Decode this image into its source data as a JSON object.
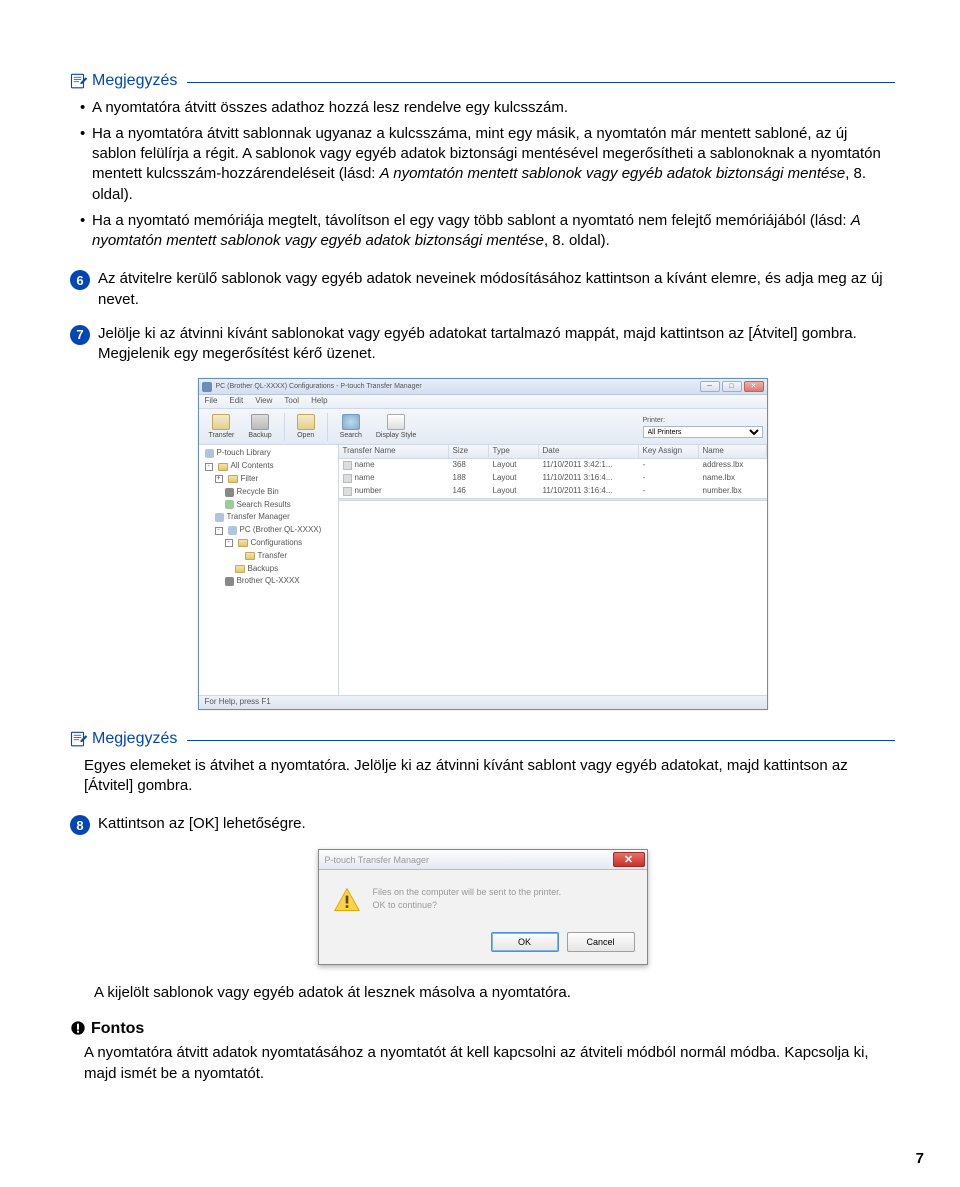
{
  "note1": {
    "title": "Megjegyzés",
    "bullets": [
      "A nyomtatóra átvitt összes adathoz hozzá lesz rendelve egy kulcsszám.",
      "Ha a nyomtatóra átvitt sablonnak ugyanaz a kulcsszáma, mint egy másik, a nyomtatón már mentett sabloné, az új sablon felülírja a régit. A sablonok vagy egyéb adatok biztonsági mentésével megerősítheti a sablonoknak a nyomtatón mentett kulcsszám-hozzárendeléseit (lásd: A nyomtatón mentett sablonok vagy egyéb adatok biztonsági mentése, 8. oldal).",
      "Ha a nyomtató memóriája megtelt, távolítson el egy vagy több sablont a nyomtató nem felejtő memóriájából (lásd: A nyomtatón mentett sablonok vagy egyéb adatok biztonsági mentése, 8. oldal)."
    ]
  },
  "step6": {
    "num": "6",
    "text": "Az átvitelre kerülő sablonok vagy egyéb adatok neveinek módosításához kattintson a kívánt elemre, és adja meg az új nevet."
  },
  "step7": {
    "num": "7",
    "text": "Jelölje ki az átvinni kívánt sablonokat vagy egyéb adatokat tartalmazó mappát, majd kattintson az [Átvitel] gombra. Megjelenik egy megerősítést kérő üzenet."
  },
  "app": {
    "title": "PC (Brother QL-XXXX) Configurations - P-touch Transfer Manager",
    "menus": [
      "File",
      "Edit",
      "View",
      "Tool",
      "Help"
    ],
    "tools": [
      "Transfer",
      "Backup",
      "Open",
      "Search",
      "Display Style"
    ],
    "printer_label": "Printer:",
    "printer_value": "All Printers",
    "tree": {
      "root": "P-touch Library",
      "items": [
        "All Contents",
        "Filter",
        "Recycle Bin",
        "Search Results",
        "Transfer Manager"
      ],
      "pc_node": "PC (Brother QL-XXXX)",
      "pc_children": [
        "Configurations",
        "Transfer",
        "Backups"
      ],
      "device": "Brother QL-XXXX"
    },
    "columns": [
      "Transfer Name",
      "Size",
      "Type",
      "Date",
      "Key Assign",
      "Name"
    ],
    "rows": [
      {
        "name": "name",
        "size": "368",
        "type": "Layout",
        "date": "11/10/2011 3:42:1...",
        "key": "-",
        "fname": "address.lbx"
      },
      {
        "name": "name",
        "size": "188",
        "type": "Layout",
        "date": "11/10/2011 3:16:4...",
        "key": "-",
        "fname": "name.lbx"
      },
      {
        "name": "number",
        "size": "146",
        "type": "Layout",
        "date": "11/10/2011 3:16:4...",
        "key": "-",
        "fname": "number.lbx"
      }
    ],
    "status": "For Help, press F1"
  },
  "note2": {
    "title": "Megjegyzés",
    "text": "Egyes elemeket is átvihet a nyomtatóra. Jelölje ki az átvinni kívánt sablont vagy egyéb adatokat, majd kattintson az [Átvitel] gombra."
  },
  "step8": {
    "num": "8",
    "text": "Kattintson az [OK] lehetőségre."
  },
  "dialog": {
    "title": "P-touch Transfer Manager",
    "line1": "Files on the computer will be sent to the printer.",
    "line2": "OK to continue?",
    "ok": "OK",
    "cancel": "Cancel"
  },
  "after_dialog": "A kijelölt sablonok vagy egyéb adatok át lesznek másolva a nyomtatóra.",
  "important": {
    "title": "Fontos",
    "text": "A nyomtatóra átvitt adatok nyomtatásához a nyomtatót át kell kapcsolni az átviteli módból normál módba. Kapcsolja ki, majd ismét be a nyomtatót."
  },
  "page_number": "7"
}
